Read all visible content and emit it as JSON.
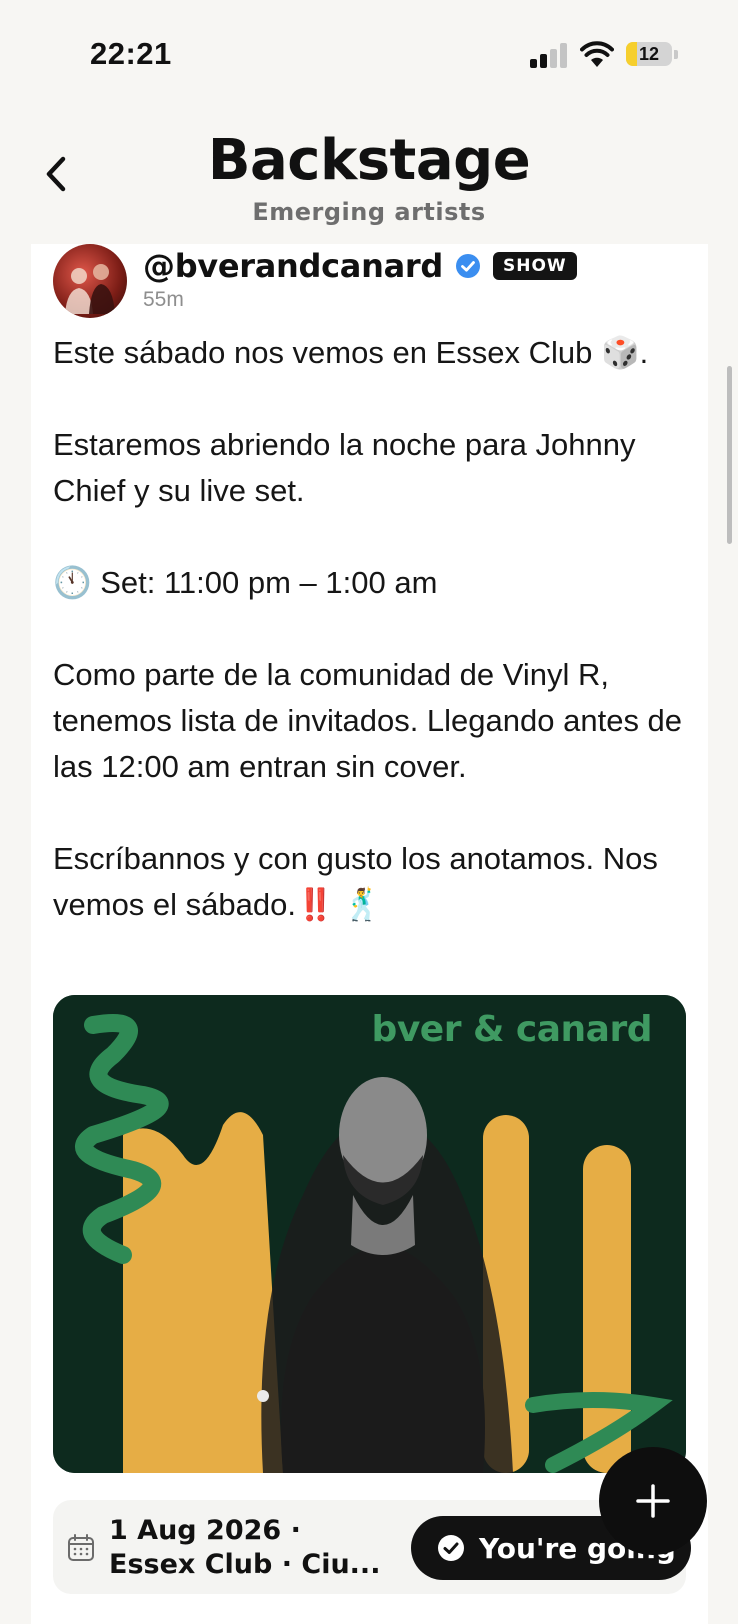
{
  "status_bar": {
    "time": "22:21",
    "battery": "12"
  },
  "header": {
    "title": "Backstage",
    "subtitle": "Emerging artists"
  },
  "post": {
    "handle": "@bverandcanard",
    "badge": "SHOW",
    "timestamp": "55m",
    "body": "Este sábado nos vemos en Essex Club 🎲.\n\nEstaremos abriendo la noche para Johnny Chief y su live set.\n\n🕚 Set: 11:00 pm – 1:00 am\n\nComo parte de la comunidad de Vinyl R, tenemos lista de invitados. Llegando antes de las 12:00 am entran sin cover.\n\nEscríbannos y con gusto los anotamos. Nos vemos el sábado.‼️ 🕺",
    "image_brand": "bver & canard"
  },
  "event": {
    "line1": "1 Aug 2026 ·",
    "line2": "Essex Club · Ciu...",
    "going_label": "You're going"
  },
  "colors": {
    "accent_blue": "#3b8ef0",
    "image_bg": "#0d2a1e",
    "image_green": "#3f9a62",
    "image_yellow": "#e6ad45"
  }
}
